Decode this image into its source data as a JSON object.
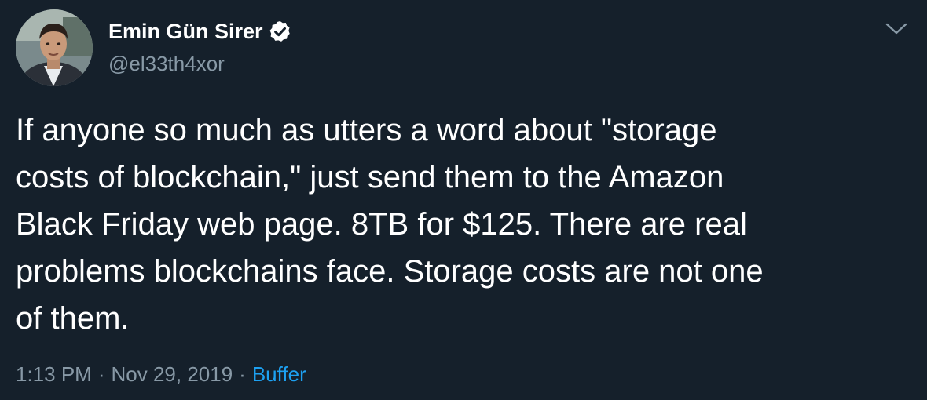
{
  "author": {
    "display_name": "Emin Gün Sirer",
    "handle": "@el33th4xor",
    "verified": true
  },
  "tweet": {
    "lines": [
      "If anyone so much as utters a word about \"storage",
      "costs of blockchain,\" just send them to the Amazon",
      "Black Friday web page. 8TB for $125. There are real",
      "problems blockchains face. Storage costs are not one",
      "of them."
    ],
    "time": "1:13 PM",
    "date": "Nov 29, 2019",
    "separator": "·",
    "source": "Buffer"
  },
  "icons": {
    "verified": "verified-badge-icon",
    "menu": "chevron-down-icon"
  },
  "colors": {
    "background": "#15202b",
    "text": "#ffffff",
    "secondary_text": "#8899a6",
    "link": "#1da1f2"
  }
}
